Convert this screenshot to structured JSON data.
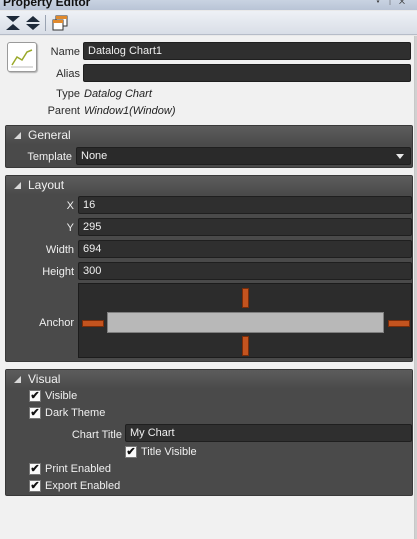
{
  "window": {
    "title": "Property Editor",
    "controls": [
      "▾",
      "ᛘ",
      "✕"
    ]
  },
  "header": {
    "name_label": "Name",
    "name_value": "Datalog Chart1",
    "alias_label": "Alias",
    "alias_value": "",
    "type_label": "Type",
    "type_value": "Datalog Chart",
    "parent_label": "Parent",
    "parent_value": "Window1(Window)"
  },
  "general": {
    "title": "General",
    "template_label": "Template",
    "template_value": "None"
  },
  "layout": {
    "title": "Layout",
    "x_label": "X",
    "x_value": "16",
    "y_label": "Y",
    "y_value": "295",
    "width_label": "Width",
    "width_value": "694",
    "height_label": "Height",
    "height_value": "300",
    "anchor_label": "Anchor"
  },
  "visual": {
    "title": "Visual",
    "visible_label": "Visible",
    "visible_checked": true,
    "dark_theme_label": "Dark Theme",
    "dark_theme_checked": true,
    "chart_title_label": "Chart Title",
    "chart_title_value": "My Chart",
    "title_visible_label": "Title Visible",
    "title_visible_checked": true,
    "print_enabled_label": "Print Enabled",
    "print_enabled_checked": true,
    "export_enabled_label": "Export Enabled",
    "export_enabled_checked": true
  },
  "colors": {
    "accent_handle": "#c4541f",
    "group_bg": "#4a4a4a",
    "field_bg": "#2f2f2f"
  },
  "icons": [
    "collapse-all-icon",
    "expand-all-icon",
    "window-icon",
    "chart-icon",
    "checkmark-icon"
  ],
  "check_glyph": "✔"
}
